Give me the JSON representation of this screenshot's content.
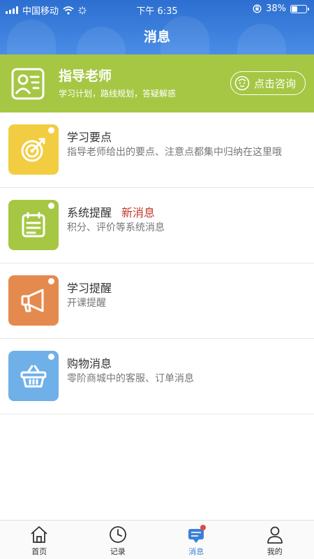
{
  "status_bar": {
    "carrier": "中国移动",
    "time": "下午 6:35",
    "battery": "38%",
    "battery_level": 0.38
  },
  "header": {
    "title": "消息"
  },
  "banner": {
    "name": "指导老师",
    "subtitle": "学习计划，路线规划，答疑解惑",
    "consult_label": "点击咨询"
  },
  "messages": [
    {
      "title": "学习要点",
      "badge": "",
      "desc": "指导老师给出的要点、注意点都集中归纳在这里哦",
      "color": "#f2cd42",
      "icon": "target-icon"
    },
    {
      "title": "系统提醒",
      "badge": "新消息",
      "desc": "积分、评价等系统消息",
      "color": "#a6c744",
      "icon": "calendar-list-icon"
    },
    {
      "title": "学习提醒",
      "badge": "",
      "desc": "开课提醒",
      "color": "#e58a4e",
      "icon": "megaphone-icon"
    },
    {
      "title": "购物消息",
      "badge": "",
      "desc": "零阶商城中的客服、订单消息",
      "color": "#6fb0e8",
      "icon": "basket-icon"
    }
  ],
  "tabs": [
    {
      "label": "首页",
      "icon": "home-icon"
    },
    {
      "label": "记录",
      "icon": "clock-icon"
    },
    {
      "label": "消息",
      "icon": "message-icon"
    },
    {
      "label": "我的",
      "icon": "person-icon"
    }
  ],
  "colors": {
    "header_blue": "#3b7fdc",
    "banner_green": "#a6c744",
    "active_tab": "#3b80d8",
    "badge_red": "#c0392b"
  }
}
